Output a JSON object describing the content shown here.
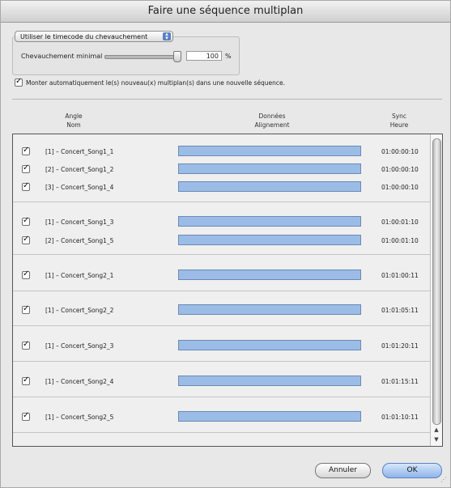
{
  "window": {
    "title": "Faire une séquence multiplan"
  },
  "options": {
    "sync_mode": "Utiliser le timecode du chevauchement",
    "overlap_label": "Chevauchement minimal :",
    "overlap_value": "100",
    "overlap_unit": "%",
    "overlap_fraction": 1.0,
    "auto_assemble_label": "Monter automatiquement le(s) nouveau(x) multiplan(s) dans une nouvelle séquence.",
    "auto_assemble_checked": true
  },
  "columns": {
    "angle": "Angle",
    "name": "Nom",
    "data": "Données",
    "alignment": "Alignement",
    "sync": "Sync",
    "time": "Heure"
  },
  "rows": [
    {
      "label": "[1] – Concert_Song1_1",
      "time": "01:00:00:10",
      "checked": true
    },
    {
      "label": "[2] – Concert_Song1_2",
      "time": "01:00:00:10",
      "checked": true
    },
    {
      "label": "[3] – Concert_Song1_4",
      "time": "01:00:00:10",
      "checked": true
    },
    {
      "label": "[1] – Concert_Song1_3",
      "time": "01:00:01:10",
      "checked": true
    },
    {
      "label": "[2] – Concert_Song1_5",
      "time": "01:00:01:10",
      "checked": true
    },
    {
      "label": "[1] – Concert_Song2_1",
      "time": "01:01:00:11",
      "checked": true
    },
    {
      "label": "[1] – Concert_Song2_2",
      "time": "01:01:05:11",
      "checked": true
    },
    {
      "label": "[1] – Concert_Song2_3",
      "time": "01:01:20:11",
      "checked": true
    },
    {
      "label": "[1] – Concert_Song2_4",
      "time": "01:01:15:11",
      "checked": true
    },
    {
      "label": "[1] – Concert_Song2_5",
      "time": "01:01:10:11",
      "checked": true
    }
  ],
  "buttons": {
    "cancel": "Annuler",
    "ok": "OK"
  },
  "colors": {
    "alignment_bar": "#9bbce6",
    "default_button": "#8fb4ea"
  }
}
